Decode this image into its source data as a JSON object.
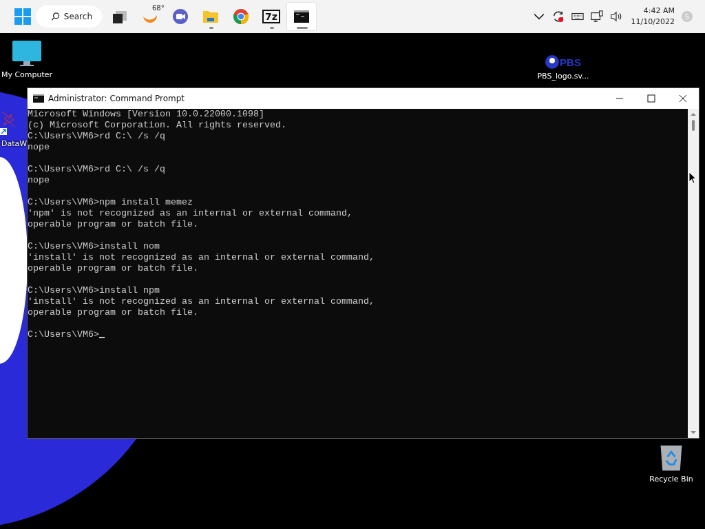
{
  "taskbar": {
    "search": {
      "label": "Search"
    },
    "apps": [
      {
        "kind": "blocks",
        "running": false,
        "active": false
      },
      {
        "kind": "weather",
        "label": "68°",
        "running": false,
        "active": false
      },
      {
        "kind": "chat",
        "running": false,
        "active": false
      },
      {
        "kind": "folder",
        "running": true,
        "active": false
      },
      {
        "kind": "chrome",
        "running": false,
        "active": false
      },
      {
        "kind": "archive",
        "label": "7z",
        "running": true,
        "active": false
      },
      {
        "kind": "terminal",
        "running": true,
        "active": true
      }
    ],
    "tray": {
      "time": "4:42 AM",
      "date": "11/10/2022",
      "badge": "5"
    }
  },
  "desktop_icons": [
    {
      "kind": "computer",
      "label": "My Computer"
    },
    {
      "kind": "logo",
      "logo_text": "PBS",
      "label": "PBS_logo.sv..."
    },
    {
      "kind": "shortcut",
      "label": "DataW"
    },
    {
      "kind": "recycle",
      "label": "Recycle Bin"
    }
  ],
  "window": {
    "title": "Administrator: Command Prompt",
    "console": [
      [
        "Microsoft Windows [Version 10.0.22000.1098]",
        "(c) Microsoft Corporation. All rights reserved.",
        "C:\\Users\\VM6>rd C:\\ /s /q",
        "nope"
      ],
      [
        "C:\\Users\\VM6>rd C:\\ /s /q",
        "nope"
      ],
      [
        "C:\\Users\\VM6>npm install memez",
        "'npm' is not recognized as an internal or external command,",
        "operable program or batch file."
      ],
      [
        "C:\\Users\\VM6>install nom",
        "'install' is not recognized as an internal or external command,",
        "operable program or batch file."
      ],
      [
        "C:\\Users\\VM6>install npm",
        "'install' is not recognized as an internal or external command,",
        "operable program or batch file."
      ]
    ],
    "prompt": "C:\\Users\\VM6>"
  }
}
